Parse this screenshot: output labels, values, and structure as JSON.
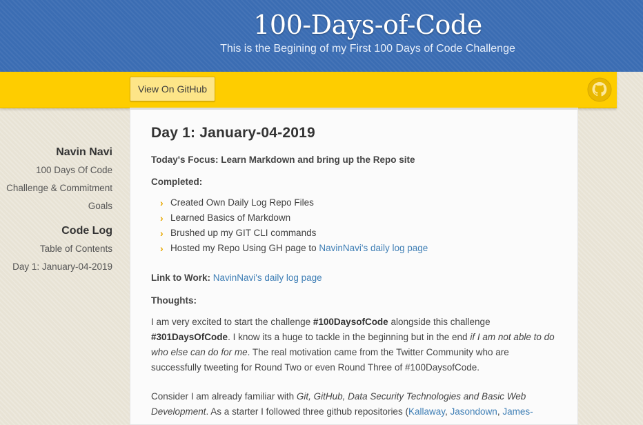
{
  "header": {
    "title": "100-Days-of-Code",
    "tagline": "This is the Begining of my First 100 Days of Code Challenge"
  },
  "banner": {
    "github_button": "View On GitHub"
  },
  "sidebar": {
    "author": "Navin Navi",
    "author_links": [
      "100 Days Of Code",
      "Challenge & Commitment",
      "Goals"
    ],
    "section": "Code Log",
    "section_links": [
      "Table of Contents",
      "Day 1: January-04-2019"
    ]
  },
  "content": {
    "title": "Day 1: January-04-2019",
    "focus_label": "Today's Focus:",
    "focus_text": "Learn Markdown and bring up the Repo site",
    "completed_label": "Completed:",
    "completed_items": [
      "Created Own Daily Log Repo Files",
      "Learned Basics of Markdown",
      "Brushed up my GIT CLI commands",
      "Hosted my Repo Using GH page to"
    ],
    "completed_link": "NavinNavi's daily log page",
    "link_label": "Link to Work:",
    "link_text": "NavinNavi's daily log page",
    "thoughts_label": "Thoughts:",
    "p1_a": "I am very excited to start the challenge",
    "p1_tag1": "#100DaysofCode",
    "p1_b": "alongside this challenge",
    "p1_tag2": "#301DaysOfCode",
    "p1_c": ". I know its a huge to tackle in the beginning but in the end",
    "p1_italic": "if I am not able to do who else can do for me",
    "p1_d": ". The real motivation came from the Twitter Community who are successfully tweeting for Round Two or even Round Three of #100DaysofCode.",
    "p2_a": "Consider I am already familiar with",
    "p2_italic": "Git, GitHub, Data Security Technologies and Basic Web Development",
    "p2_b": ". As a starter I followed three github repositories (",
    "p2_link1": "Kallaway",
    "p2_link2": "Jasondown",
    "p2_link3": "James-"
  },
  "colors": {
    "header_blue": "#3b6db3",
    "banner_yellow": "#fecd00",
    "link_blue": "#3e7eb5",
    "bullet_gold": "#e8a800"
  },
  "icons": {
    "github": "octocat-icon",
    "bullet": "chevron-right-icon"
  }
}
